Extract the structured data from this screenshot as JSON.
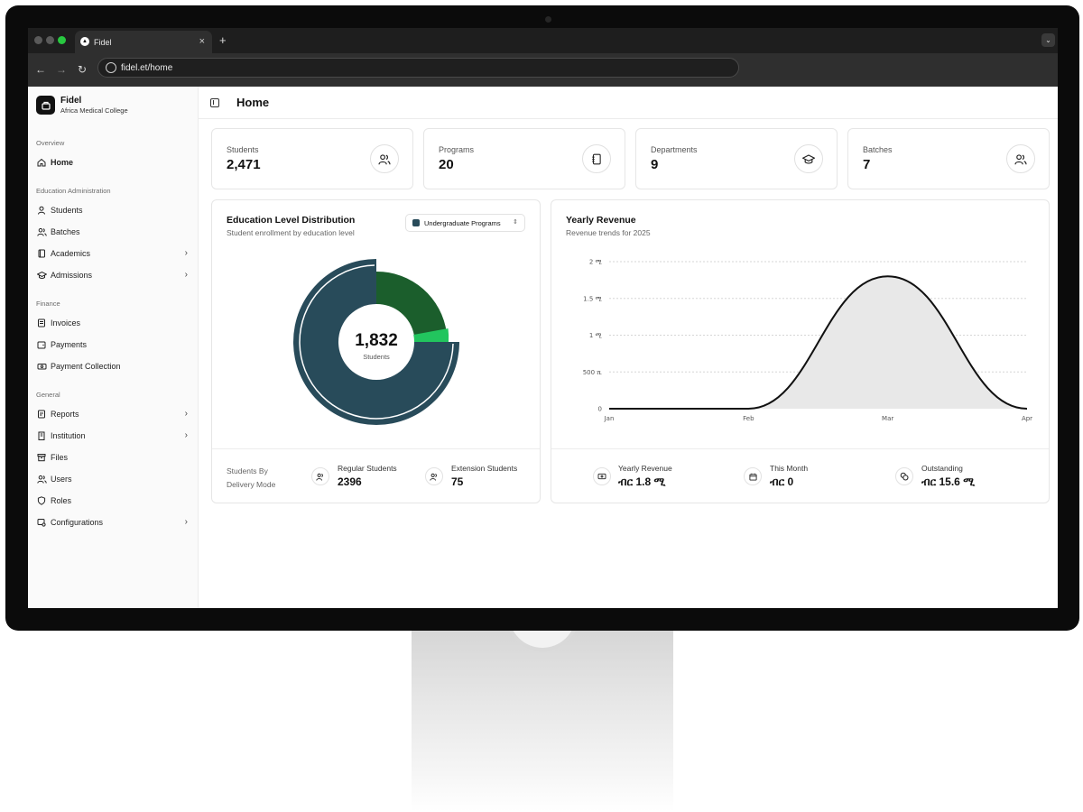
{
  "browser": {
    "tab_title": "Fidel",
    "url": "fidel.et/home",
    "new_tab_glyph": "+",
    "close_glyph": "×"
  },
  "brand": {
    "name": "Fidel",
    "subtitle": "Africa Medical College"
  },
  "sidebar": {
    "sections": [
      {
        "label": "Overview",
        "items": [
          {
            "label": "Home",
            "icon": "home-icon",
            "active": true
          }
        ]
      },
      {
        "label": "Education Administration",
        "items": [
          {
            "label": "Students",
            "icon": "user-icon"
          },
          {
            "label": "Batches",
            "icon": "users-icon"
          },
          {
            "label": "Academics",
            "icon": "book-icon",
            "expandable": true
          },
          {
            "label": "Admissions",
            "icon": "graduation-cap-icon",
            "expandable": true
          }
        ]
      },
      {
        "label": "Finance",
        "items": [
          {
            "label": "Invoices",
            "icon": "invoice-icon"
          },
          {
            "label": "Payments",
            "icon": "wallet-icon"
          },
          {
            "label": "Payment Collection",
            "icon": "banknote-icon"
          }
        ]
      },
      {
        "label": "General",
        "items": [
          {
            "label": "Reports",
            "icon": "report-icon",
            "expandable": true
          },
          {
            "label": "Institution",
            "icon": "building-icon",
            "expandable": true
          },
          {
            "label": "Files",
            "icon": "archive-icon"
          },
          {
            "label": "Users",
            "icon": "users-icon"
          },
          {
            "label": "Roles",
            "icon": "shield-icon"
          },
          {
            "label": "Configurations",
            "icon": "settings-icon",
            "expandable": true
          }
        ]
      }
    ]
  },
  "page": {
    "title": "Home"
  },
  "stats": [
    {
      "label": "Students",
      "value": "2,471",
      "icon": "users-icon"
    },
    {
      "label": "Programs",
      "value": "20",
      "icon": "notebook-icon"
    },
    {
      "label": "Departments",
      "value": "9",
      "icon": "graduation-cap-icon"
    },
    {
      "label": "Batches",
      "value": "7",
      "icon": "users-icon"
    }
  ],
  "distribution": {
    "title": "Education Level Distribution",
    "subtitle": "Student enrollment by education level",
    "selected_program": "Undergraduate Programs",
    "center_value": "1,832",
    "center_label": "Students",
    "colors": {
      "primary": "#284b5a",
      "dark_green": "#1b5e2c",
      "light_green": "#22c55e"
    },
    "footer": {
      "label": "Students By Delivery Mode",
      "regular_label": "Regular Students",
      "regular_value": "2396",
      "extension_label": "Extension Students",
      "extension_value": "75"
    }
  },
  "chart_data": {
    "type": "area",
    "title": "Yearly Revenue",
    "subtitle": "Revenue trends for 2025",
    "categories": [
      "Jan",
      "Feb",
      "Mar",
      "Apr"
    ],
    "y_ticks": [
      "0",
      "500 ሺ",
      "1 ሚ",
      "1.5 ሚ",
      "2 ሚ"
    ],
    "ylim": [
      0,
      2000000
    ],
    "series": [
      {
        "values": [
          0,
          0,
          1800000,
          0
        ]
      }
    ],
    "grid": true
  },
  "revenue_footer": {
    "yearly_label": "Yearly Revenue",
    "yearly_value": "ብር 1.8 ሚ",
    "month_label": "This Month",
    "month_value": "ብር 0",
    "outstanding_label": "Outstanding",
    "outstanding_value": "ብር 15.6 ሚ"
  }
}
